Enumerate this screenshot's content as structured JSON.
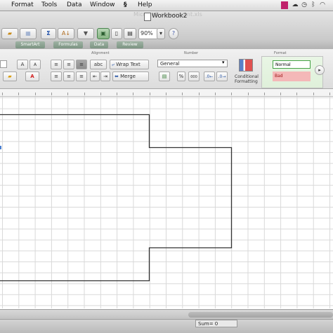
{
  "menubar": {
    "items": [
      "Format",
      "Tools",
      "Data",
      "Window",
      "Help"
    ]
  },
  "titlebar": {
    "faded_title": "Microsoft powerpoint.xls",
    "document_title": "Workbook2"
  },
  "toolbar": {
    "zoom": "90%"
  },
  "ribbon_tabs": [
    "SmartArt",
    "Formulas",
    "Data",
    "Review"
  ],
  "ribbon": {
    "group_alignment": "Alignment",
    "group_number": "Number",
    "group_format": "Format",
    "wrap_text": "Wrap Text",
    "merge": "Merge",
    "abc": "abc",
    "number_format": "General",
    "conditional_formatting_line1": "Conditional",
    "conditional_formatting_line2": "Formatting",
    "style_normal": "Normal",
    "style_bad": "Bad",
    "percent": "%",
    "thousands": "000"
  },
  "status": {
    "sum": "Sum= 0"
  }
}
